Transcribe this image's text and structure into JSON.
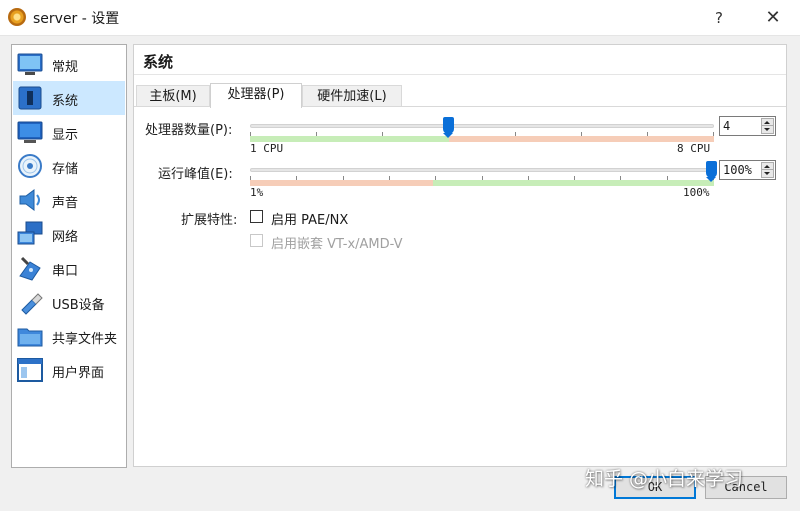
{
  "window": {
    "title": "server - 设置",
    "help": "?",
    "close": "✕"
  },
  "sidebar": {
    "items": [
      {
        "label": "常规",
        "icon": "general-icon"
      },
      {
        "label": "系统",
        "icon": "system-icon",
        "active": true
      },
      {
        "label": "显示",
        "icon": "display-icon"
      },
      {
        "label": "存储",
        "icon": "storage-icon"
      },
      {
        "label": "声音",
        "icon": "audio-icon"
      },
      {
        "label": "网络",
        "icon": "network-icon"
      },
      {
        "label": "串口",
        "icon": "serial-port-icon"
      },
      {
        "label": "USB设备",
        "icon": "usb-icon"
      },
      {
        "label": "共享文件夹",
        "icon": "shared-folder-icon"
      },
      {
        "label": "用户界面",
        "icon": "user-interface-icon"
      }
    ]
  },
  "panel": {
    "title": "系统",
    "tabs": [
      {
        "label": "主板(M)"
      },
      {
        "label": "处理器(P)",
        "active": true
      },
      {
        "label": "硬件加速(L)"
      }
    ]
  },
  "processor": {
    "cpu_count": {
      "label": "处理器数量(P):",
      "value": "4",
      "min_label": "1 CPU",
      "max_label": "8 CPU",
      "min": 1,
      "max": 8,
      "current": 4,
      "recommended_max": 4
    },
    "execution_cap": {
      "label": "运行峰值(E):",
      "value": "100%",
      "min_label": "1%",
      "max_label": "100%",
      "min": 1,
      "max": 100,
      "current": 100,
      "warning_below": 40
    },
    "extended_features": {
      "label": "扩展特性:",
      "pae": {
        "label": "启用 PAE/NX",
        "checked": false,
        "enabled": true
      },
      "nested": {
        "label": "启用嵌套 VT-x/AMD-V",
        "checked": false,
        "enabled": false
      }
    }
  },
  "buttons": {
    "ok": "OK",
    "cancel": "Cancel"
  },
  "watermark": "知乎 @小白来学习",
  "colors": {
    "accent": "#0a6fd8",
    "selected_item": "#cce8ff",
    "safe_range": "#c7edb8",
    "warn_range": "#f6cdb8"
  }
}
